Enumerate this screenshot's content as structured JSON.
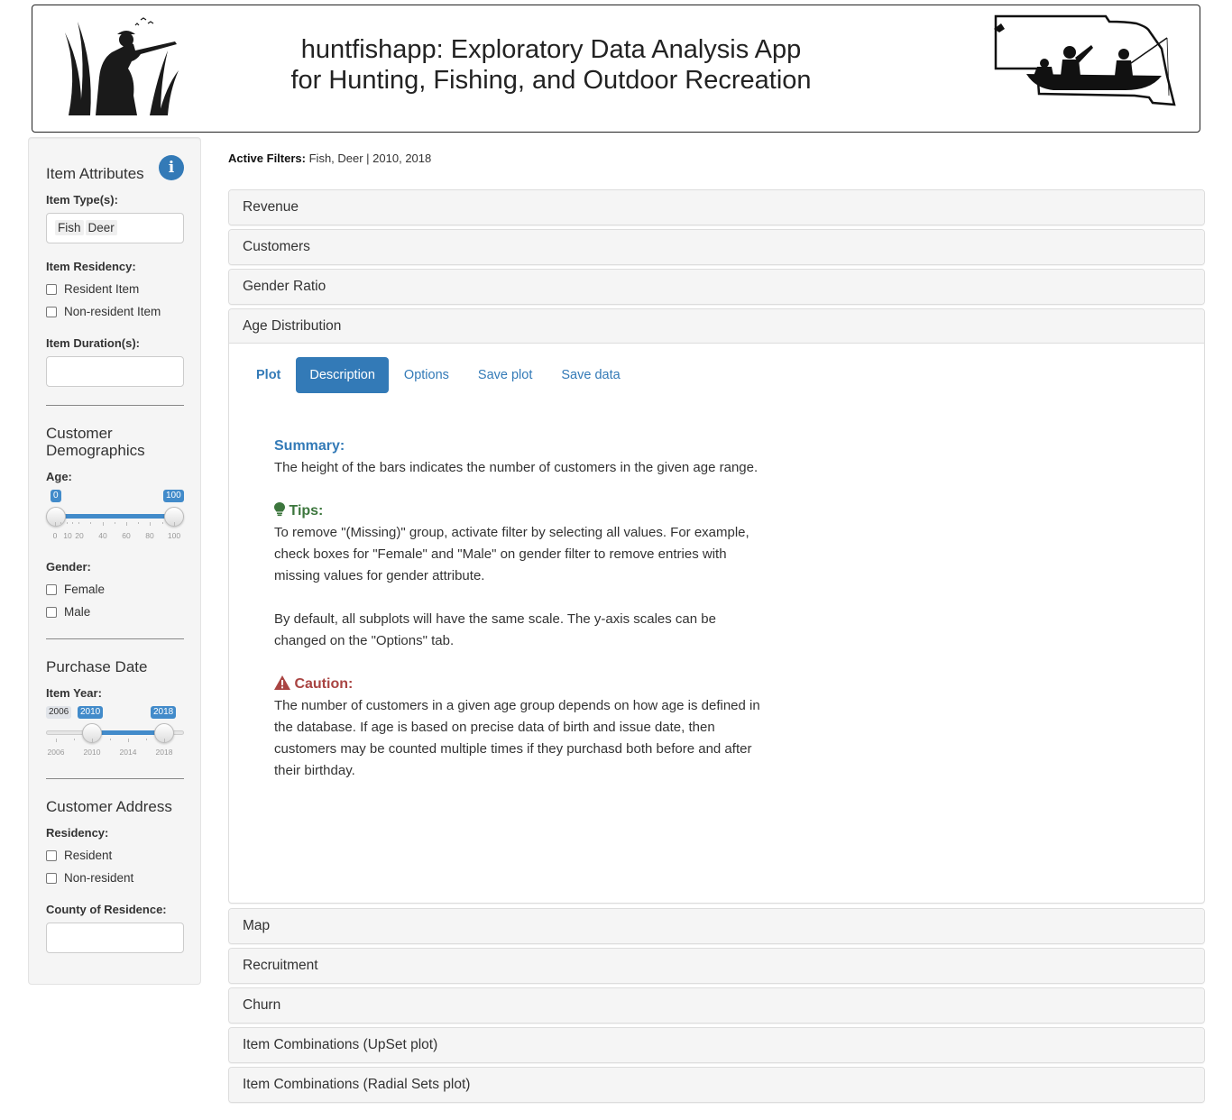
{
  "header": {
    "title_line1": "huntfishapp: Exploratory Data Analysis App",
    "title_line2": "for Hunting, Fishing, and Outdoor Recreation"
  },
  "sidebar": {
    "item_attributes": {
      "heading": "Item Attributes",
      "info_icon": "info-circle-icon",
      "item_types_label": "Item Type(s):",
      "item_types_selected": [
        "Fish",
        "Deer"
      ],
      "item_residency_label": "Item Residency:",
      "item_residency_options": [
        "Resident Item",
        "Non-resident Item"
      ],
      "item_duration_label": "Item Duration(s):",
      "item_duration_value": ""
    },
    "customer_demographics": {
      "heading": "Customer Demographics",
      "age_label": "Age:",
      "age_min": "0",
      "age_max": "100",
      "age_ticks": [
        "0",
        "10",
        "20",
        "40",
        "60",
        "80",
        "100"
      ],
      "gender_label": "Gender:",
      "gender_options": [
        "Female",
        "Male"
      ]
    },
    "purchase_date": {
      "heading": "Purchase Date",
      "item_year_label": "Item Year:",
      "range_min": "2006",
      "year_from": "2010",
      "year_to": "2018",
      "year_ticks": [
        "2006",
        "2010",
        "2014",
        "2018"
      ]
    },
    "customer_address": {
      "heading": "Customer Address",
      "residency_label": "Residency:",
      "residency_options": [
        "Resident",
        "Non-resident"
      ],
      "county_label": "County of Residence:",
      "county_value": ""
    }
  },
  "main": {
    "active_filters_label": "Active Filters:",
    "active_filters_value": "Fish, Deer | 2010, 2018",
    "panels": [
      "Revenue",
      "Customers",
      "Gender Ratio",
      "Age Distribution",
      "Map",
      "Recruitment",
      "Churn",
      "Item Combinations (UpSet plot)",
      "Item Combinations (Radial Sets plot)"
    ],
    "tabs": [
      "Plot",
      "Description",
      "Options",
      "Save plot",
      "Save data"
    ],
    "active_tab": "Description",
    "description": {
      "summary_heading": "Summary:",
      "summary_text": "The height of the bars indicates the number of customers in the given age range.",
      "tips_icon": "lightbulb-icon",
      "tips_heading": "Tips:",
      "tips_text1": "To remove \"(Missing)\" group, activate filter by selecting all values. For example, check boxes for \"Female\" and \"Male\" on gender filter to remove entries with missing values for gender attribute.",
      "tips_text2": "By default, all subplots will have the same scale. The y-axis scales can be changed on the \"Options\" tab.",
      "caution_icon": "warning-triangle-icon",
      "caution_heading": "Caution:",
      "caution_text": "The number of customers in a given age group depends on how age is defined in the database. If age is based on precise data of birth and issue date, then customers may be counted multiple times if they purchasd both before and after their birthday."
    }
  }
}
